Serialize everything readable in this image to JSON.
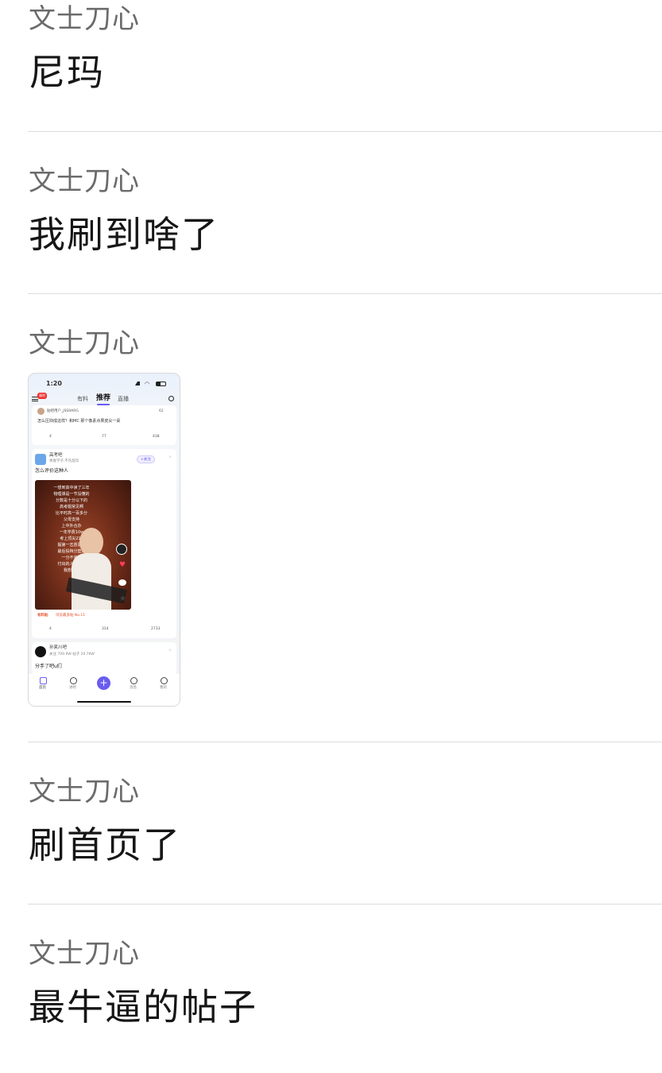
{
  "messages": [
    {
      "sender": "文士刀心",
      "text": "尼玛"
    },
    {
      "sender": "文士刀心",
      "text": "我刷到啥了"
    },
    {
      "sender": "文士刀心",
      "image": {
        "status_time": "1:20",
        "tabs": [
          "有料",
          "推荐",
          "直播"
        ],
        "active_tab": "推荐",
        "badge": "福利",
        "post1": {
          "user": "贴吧用户_JSS9ARG",
          "text": "怎么压抑成这样？和MC 那个像素点果皮尖一桌",
          "likes": "62",
          "shares": "4",
          "comments": "77",
          "upvotes": "438"
        },
        "post2": {
          "forum": "高考吧",
          "forum_sub": "青春学子,不负韶华",
          "follow": "+关注",
          "title": "怎么评价这种人",
          "video_lines": [
            "一想到高中读了三年",
            "物理课是一节没懂的",
            "分数是十分以下的",
            "高考题常见啊",
            "比平时高一百多分",
            "父母支持",
            "上中外合办",
            "一年学费10w",
            "考上顶尖211",
            "掘第一志愿录取",
            "最后投档分垫底",
            "一分不浪费",
            "付出的人上了好",
            "我想想想"
          ],
          "tag": "有料贴",
          "rank": "浏览最多贴 No.11",
          "shares": "4",
          "comments": "314",
          "upvotes": "2733"
        },
        "post3": {
          "forum": "孙笑川吧",
          "stats": "关注 709.9W  帖子 20.7KW",
          "title": "分手了吧u们"
        },
        "tabbar": [
          "首页",
          "进吧",
          "",
          "消息",
          "我的"
        ]
      }
    },
    {
      "sender": "文士刀心",
      "text": "刷首页了"
    },
    {
      "sender": "文士刀心",
      "text": "最牛逼的帖子"
    }
  ],
  "colors": {
    "sender": "#6b6b6b",
    "text": "#161616",
    "divider": "#dcdcdc",
    "accent": "#6a5cf0"
  }
}
